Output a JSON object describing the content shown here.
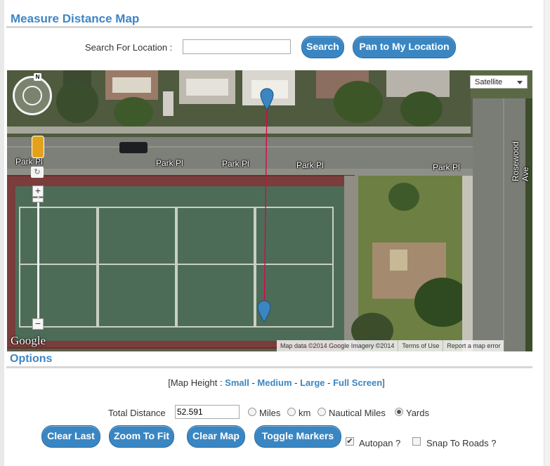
{
  "header": {
    "title": "Measure Distance Map"
  },
  "search": {
    "label": "Search For Location :",
    "value": "",
    "search_button": "Search",
    "pan_button": "Pan to My Location"
  },
  "map": {
    "map_type": "Satellite",
    "compass": "N",
    "street_labels": [
      "Park Pl",
      "Park Pl",
      "Park Pl",
      "Park Pl",
      "Park Pl",
      "Rosewood Ave"
    ],
    "logo": "Google",
    "attribution": {
      "data": "Map data ©2014 Google Imagery ©2014",
      "terms": "Terms of Use",
      "report": "Report a map error"
    },
    "line_color": "#e0004a",
    "marker_color": "#3a86c2"
  },
  "options": {
    "title": "Options",
    "height_prefix": "[Map Height : ",
    "heights": [
      "Small",
      "Medium",
      "Large",
      "Full Screen"
    ],
    "height_sep": " - ",
    "height_suffix": "]"
  },
  "distance": {
    "label": "Total Distance",
    "value": "52.591",
    "units": [
      {
        "label": "Miles",
        "checked": false
      },
      {
        "label": "km",
        "checked": false
      },
      {
        "label": "Nautical Miles",
        "checked": false
      },
      {
        "label": "Yards",
        "checked": true
      }
    ]
  },
  "actions": {
    "clear_last": "Clear Last",
    "zoom_to_fit": "Zoom To Fit",
    "clear_map": "Clear Map",
    "toggle_markers": "Toggle Markers",
    "autopan_label": "Autopan ?",
    "autopan_checked": true,
    "snap_label": "Snap To Roads ?",
    "snap_checked": false
  },
  "colors": {
    "accent": "#3d85c6",
    "button": "#3a86c2"
  }
}
